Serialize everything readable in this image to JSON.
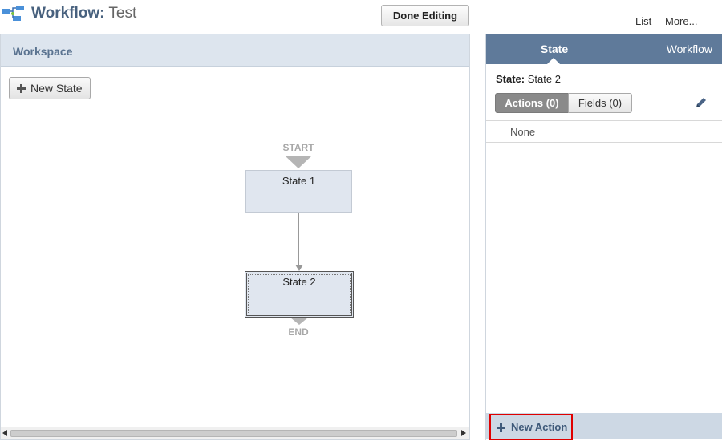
{
  "header": {
    "title_label": "Workflow:",
    "title_value": "Test",
    "done_button": "Done Editing",
    "links": [
      "List",
      "More..."
    ]
  },
  "workspace": {
    "title": "Workspace",
    "new_state_button": "New State",
    "start_label": "START",
    "end_label": "END",
    "states": [
      {
        "name": "State 1",
        "selected": false
      },
      {
        "name": "State 2",
        "selected": true
      }
    ]
  },
  "panel": {
    "tabs": [
      {
        "label": "State",
        "active": true
      },
      {
        "label": "Workflow",
        "active": false
      }
    ],
    "state_label": "State:",
    "state_value": "State 2",
    "segments": [
      {
        "label": "Actions (0)",
        "active": true
      },
      {
        "label": "Fields (0)",
        "active": false
      }
    ],
    "empty_text": "None",
    "new_action_button": "New Action",
    "icons": {
      "edit": "pencil-icon",
      "add": "plus-icon"
    }
  },
  "colors": {
    "tab_bar": "#5f7a9a",
    "workspace_header": "#dde5ee",
    "state_box": "#e0e6ef",
    "highlight": "#e00000"
  }
}
